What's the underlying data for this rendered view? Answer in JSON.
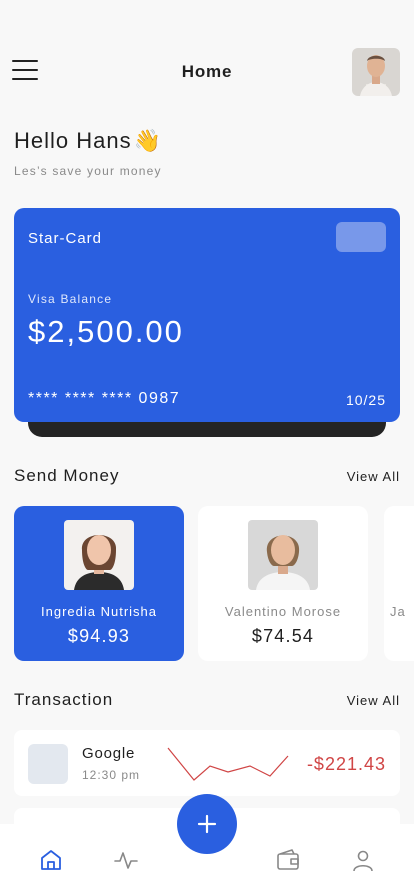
{
  "header": {
    "title": "Home",
    "menu_icon": "hamburger-menu-icon",
    "avatar": "profile-photo"
  },
  "greeting": {
    "title": "Hello Hans",
    "emoji": "👋",
    "subtitle": "Les’s save your money"
  },
  "card": {
    "brand": "Star-Card",
    "balance_label": "Visa Balance",
    "balance": "$2,500.00",
    "number": "**** **** **** 0987",
    "expiry": "10/25",
    "color": "#2a5fe0"
  },
  "send_money": {
    "title": "Send Money",
    "view_all": "View All",
    "contacts": [
      {
        "name": "Ingredia Nutrisha",
        "amount": "$94.93",
        "active": true
      },
      {
        "name": "Valentino Morose",
        "amount": "$74.54",
        "active": false
      },
      {
        "name": "Ja",
        "amount": "",
        "active": false
      }
    ]
  },
  "transactions": {
    "title": "Transaction",
    "view_all": "View All",
    "items": [
      {
        "name": "Google",
        "time": "12:30 pm",
        "amount": "-$221.43",
        "amount_color": "#d04545"
      }
    ]
  },
  "nav": {
    "items": [
      "home-icon",
      "activity-icon",
      "wallet-icon",
      "profile-icon"
    ],
    "active": "home-icon",
    "fab_icon": "plus-icon"
  },
  "colors": {
    "accent": "#2a5fe0",
    "negative": "#d04545"
  }
}
